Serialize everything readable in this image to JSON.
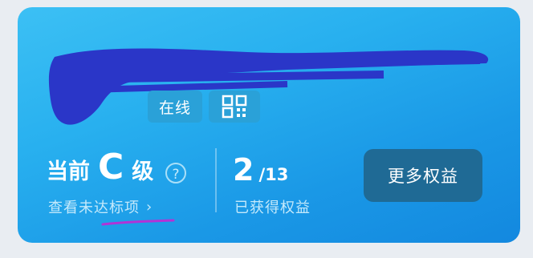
{
  "profile": {
    "status_badge": "在线",
    "qr_icon": "qr-code-icon"
  },
  "membership": {
    "level_prefix": "当前",
    "level_grade": "C",
    "level_suffix": "级",
    "help_symbol": "?",
    "view_unmet_label": "查看未达标项",
    "chevron": "›"
  },
  "benefits": {
    "obtained_count": "2",
    "total_count": "/13",
    "obtained_label": "已获得权益",
    "more_button_label": "更多权益"
  },
  "colors": {
    "card_gradient_start": "#3cc0f4",
    "card_gradient_end": "#1388df",
    "button_bg": "#1f6a95",
    "redaction": "#2a36c8",
    "pen_underline": "#b233d6"
  }
}
